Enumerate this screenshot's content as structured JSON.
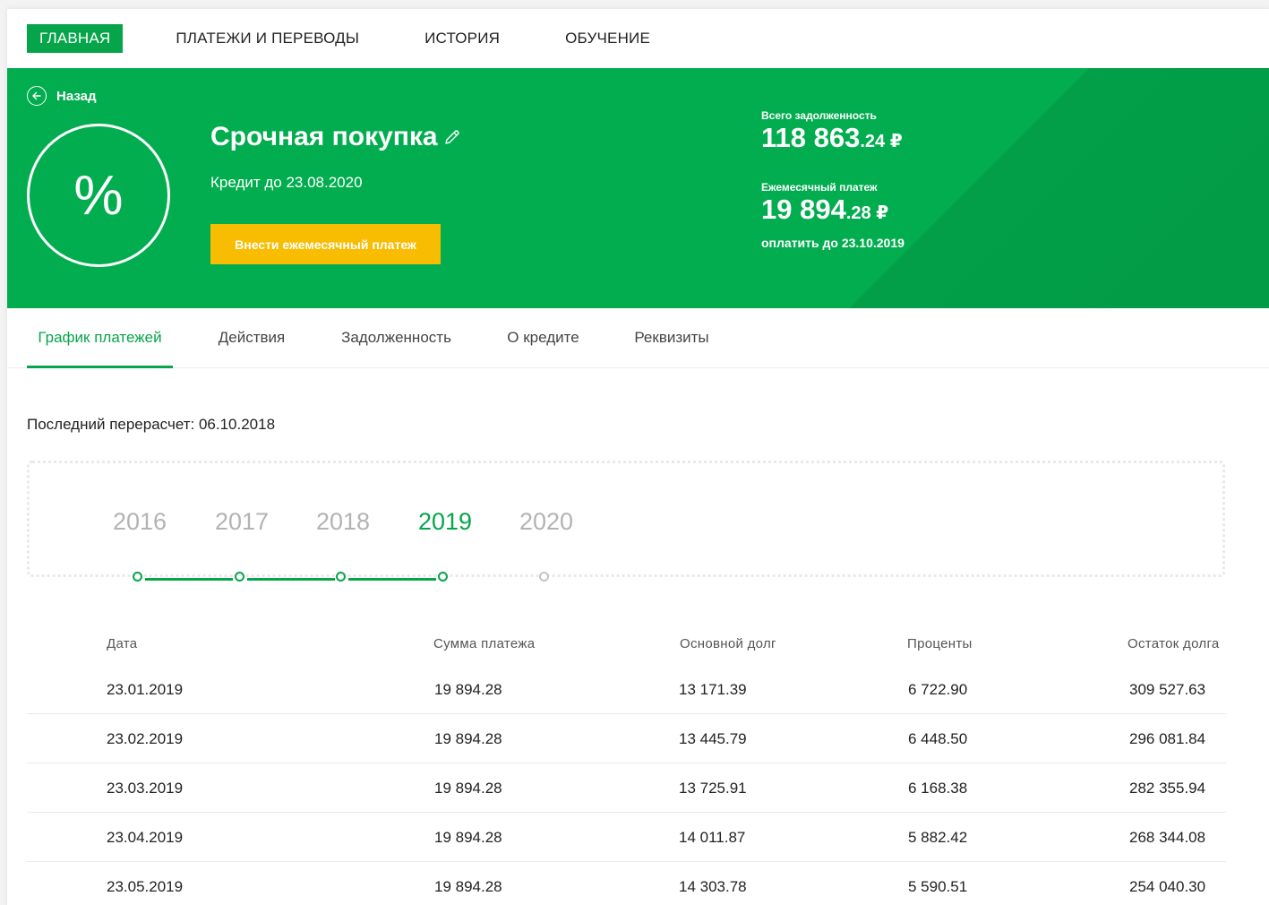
{
  "nav": {
    "items": [
      "ГЛАВНАЯ",
      "ПЛАТЕЖИ И ПЕРЕВОДЫ",
      "ИСТОРИЯ",
      "ОБУЧЕНИЕ"
    ],
    "active": "ГЛАВНАЯ"
  },
  "hero": {
    "back_label": "Назад",
    "icon_symbol": "%",
    "title": "Срочная покупка",
    "subtitle": "Кредит до 23.08.2020",
    "pay_button": "Внести ежемесячный платеж",
    "total_label": "Всего задолженность",
    "total_int": "118 863",
    "total_dec": ".24 ₽",
    "monthly_label": "Ежемесячный платеж",
    "monthly_int": "19 894",
    "monthly_dec": ".28 ₽",
    "due_text": "оплатить до 23.10.2019"
  },
  "tabs": [
    "График платежей",
    "Действия",
    "Задолженность",
    "О кредите",
    "Реквизиты"
  ],
  "recalc": "Последний перерасчет: 06.10.2018",
  "timeline": {
    "years": [
      "2016",
      "2017",
      "2018",
      "2019",
      "2020"
    ],
    "active": "2019"
  },
  "table": {
    "headers": [
      "Дата",
      "Сумма платежа",
      "Основной долг",
      "Проценты",
      "Остаток долга"
    ],
    "rows": [
      [
        "23.01.2019",
        "19 894.28",
        "13 171.39",
        "6 722.90",
        "309 527.63"
      ],
      [
        "23.02.2019",
        "19 894.28",
        "13 445.79",
        "6 448.50",
        "296 081.84"
      ],
      [
        "23.03.2019",
        "19 894.28",
        "13 725.91",
        "6 168.38",
        "282 355.94"
      ],
      [
        "23.04.2019",
        "19 894.28",
        "14 011.87",
        "5 882.42",
        "268 344.08"
      ],
      [
        "23.05.2019",
        "19 894.28",
        "14 303.78",
        "5 590.51",
        "254 040.30"
      ]
    ]
  },
  "colors": {
    "brand_green": "#02ad4f",
    "accent_green": "#07a54a",
    "button_yellow": "#f8bc00"
  }
}
